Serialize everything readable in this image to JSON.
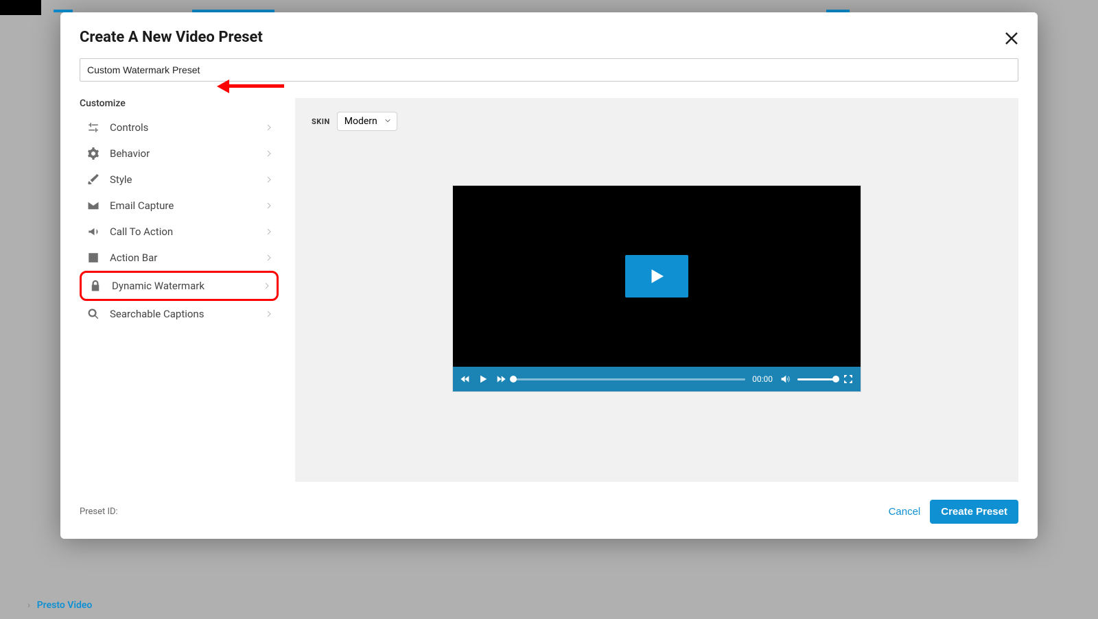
{
  "modal": {
    "title": "Create A New Video Preset"
  },
  "nameField": {
    "value": "Custom Watermark Preset"
  },
  "sidebar": {
    "heading": "Customize",
    "items": [
      {
        "label": "Controls",
        "icon": "sliders"
      },
      {
        "label": "Behavior",
        "icon": "gear"
      },
      {
        "label": "Style",
        "icon": "brush"
      },
      {
        "label": "Email Capture",
        "icon": "mail"
      },
      {
        "label": "Call To Action",
        "icon": "megaphone"
      },
      {
        "label": "Action Bar",
        "icon": "chart"
      },
      {
        "label": "Dynamic Watermark",
        "icon": "lock"
      },
      {
        "label": "Searchable Captions",
        "icon": "search"
      }
    ]
  },
  "preview": {
    "skin": {
      "label": "SKIN",
      "value": "Modern"
    },
    "player": {
      "time": "00:00"
    }
  },
  "footer": {
    "presetIdLabel": "Preset ID:",
    "cancel": "Cancel",
    "create": "Create Preset"
  },
  "breadcrumb": {
    "current": "Presto Video"
  }
}
